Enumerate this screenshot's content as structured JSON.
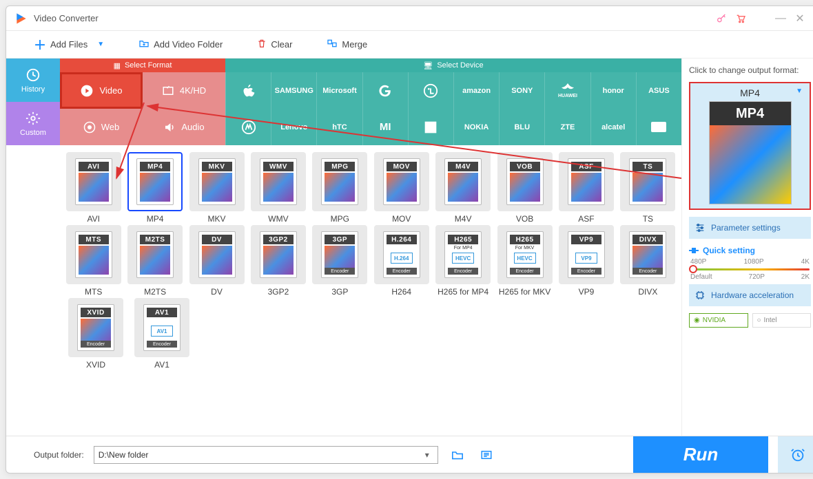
{
  "window": {
    "title": "Video Converter"
  },
  "toolbar": {
    "add_files": "Add Files",
    "add_folder": "Add Video Folder",
    "clear": "Clear",
    "merge": "Merge"
  },
  "left": {
    "history": "History",
    "custom": "Custom"
  },
  "tabs": {
    "format": "Select Format",
    "device": "Select Device"
  },
  "categories": {
    "video": "Video",
    "hd": "4K/HD",
    "web": "Web",
    "audio": "Audio"
  },
  "brands_row1": [
    "Apple",
    "SAMSUNG",
    "Microsoft",
    "G",
    "LG",
    "amazon",
    "SONY",
    "HUAWEI",
    "honor",
    "ASUS"
  ],
  "brands_row2": [
    "Moto",
    "Lenovo",
    "hTC",
    "Mi",
    "OnePlus",
    "NOKIA",
    "BLU",
    "ZTE",
    "alcatel",
    "TV"
  ],
  "formats": [
    {
      "label": "AVI",
      "bar": "AVI"
    },
    {
      "label": "MP4",
      "bar": "MP4",
      "selected": true
    },
    {
      "label": "MKV",
      "bar": "MKV"
    },
    {
      "label": "WMV",
      "bar": "WMV"
    },
    {
      "label": "MPG",
      "bar": "MPG"
    },
    {
      "label": "MOV",
      "bar": "MOV"
    },
    {
      "label": "M4V",
      "bar": "M4V"
    },
    {
      "label": "VOB",
      "bar": "VOB"
    },
    {
      "label": "ASF",
      "bar": "ASF"
    },
    {
      "label": "TS",
      "bar": "TS"
    },
    {
      "label": "MTS",
      "bar": "MTS"
    },
    {
      "label": "M2TS",
      "bar": "M2TS"
    },
    {
      "label": "DV",
      "bar": "DV"
    },
    {
      "label": "3GP2",
      "bar": "3GP2"
    },
    {
      "label": "3GP",
      "bar": "3GP",
      "sub": "Encoder"
    },
    {
      "label": "H264",
      "bar": "H.264",
      "mid": "H.264",
      "sub": "Encoder"
    },
    {
      "label": "H265 for MP4",
      "bar": "H265",
      "pre": "For MP4",
      "mid": "HEVC",
      "sub": "Encoder"
    },
    {
      "label": "H265 for MKV",
      "bar": "H265",
      "pre": "For MKV",
      "mid": "HEVC",
      "sub": "Encoder"
    },
    {
      "label": "VP9",
      "bar": "VP9",
      "mid": "VP9",
      "sub": "Encoder"
    },
    {
      "label": "DIVX",
      "bar": "DIVX",
      "sub": "Encoder"
    },
    {
      "label": "XVID",
      "bar": "XVID",
      "sub": "Encoder"
    },
    {
      "label": "AV1",
      "bar": "AV1",
      "mid": "AV1",
      "sub": "Encoder"
    }
  ],
  "right": {
    "hint": "Click to change output format:",
    "current_format": "MP4",
    "param_settings": "Parameter settings",
    "quick_setting": "Quick setting",
    "resolutions_top": [
      "480P",
      "1080P",
      "4K"
    ],
    "resolutions_bottom": [
      "Default",
      "720P",
      "2K"
    ],
    "hw_accel": "Hardware acceleration",
    "gpu_nvidia": "NVIDIA",
    "gpu_intel": "Intel"
  },
  "bottom": {
    "output_label": "Output folder:",
    "output_path": "D:\\New folder",
    "run": "Run"
  }
}
